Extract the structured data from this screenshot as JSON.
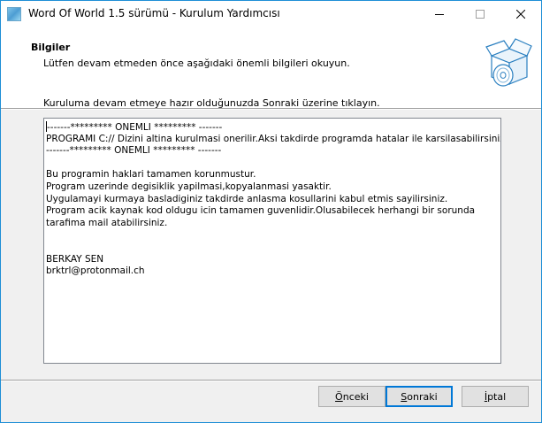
{
  "window": {
    "title": "Word Of World 1.5 sürümü - Kurulum Yardımcısı"
  },
  "header": {
    "title": "Bilgiler",
    "subtitle": "Lütfen devam etmeden önce aşağıdaki önemli bilgileri okuyun."
  },
  "instruction": "Kuruluma devam etmeye hazır olduğunuzda Sonraki üzerine tıklayın.",
  "info_text": {
    "lines": [
      "-------********* ONEMLI ********* -------",
      "PROGRAMI C:// Dizini altina kurulmasi onerilir.Aksi takdirde programda hatalar ile karsilasabilirsiniz.",
      "-------********* ONEMLI ********* -------",
      "",
      "Bu programin haklari tamamen korunmustur.",
      "Program uzerinde degisiklik yapilmasi,kopyalanmasi yasaktir.",
      "Uygulamayi kurmaya basladiginiz takdirde anlasma kosullarini kabul etmis sayilirsiniz.",
      "Program acik kaynak kod oldugu icin tamamen guvenlidir.Olusabilecek herhangi bir sorunda",
      "tarafima mail atabilirsiniz.",
      "",
      "",
      "BERKAY SEN",
      "brktrl@protonmail.ch"
    ]
  },
  "buttons": {
    "back": {
      "pre": "",
      "key": "Ö",
      "post": "nceki"
    },
    "next": {
      "pre": "",
      "key": "S",
      "post": "onraki"
    },
    "cancel": {
      "pre": "",
      "key": "İ",
      "post": "ptal"
    }
  },
  "icons": {
    "app": "installer-app-icon",
    "minimize": "minimize-icon",
    "maximize": "maximize-icon",
    "close": "close-icon",
    "header": "setup-box-disc-icon"
  }
}
